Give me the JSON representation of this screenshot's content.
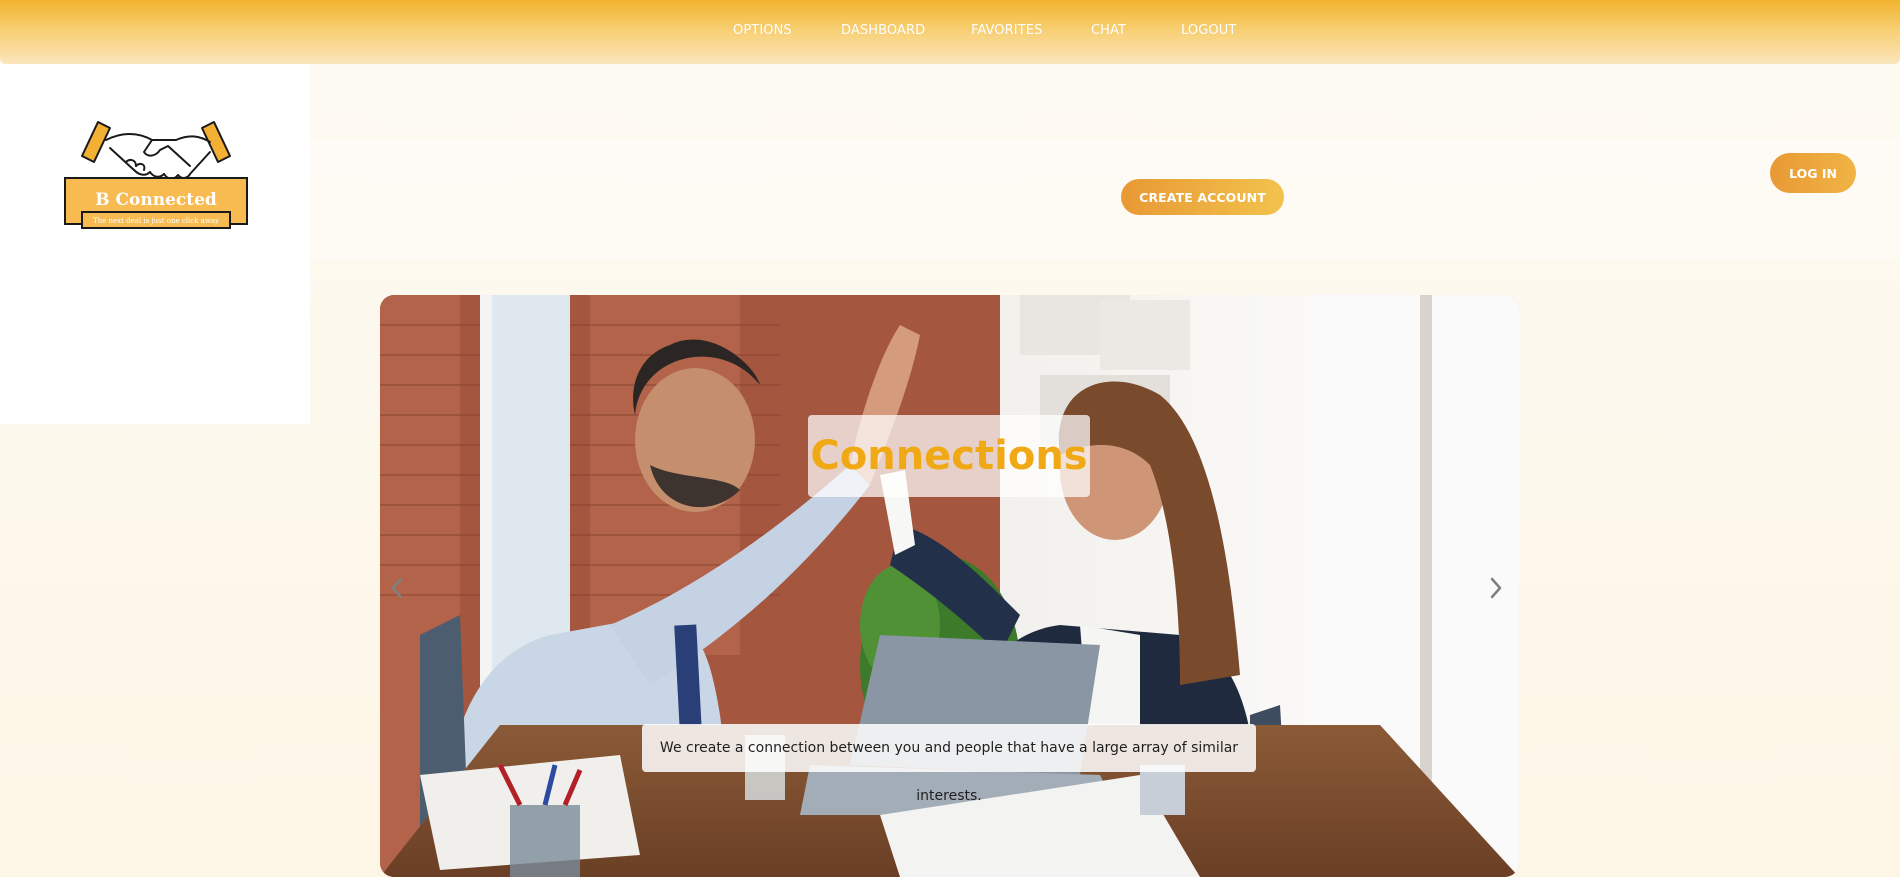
{
  "nav": {
    "items": [
      {
        "label": "OPTIONS"
      },
      {
        "label": "DASHBOARD"
      },
      {
        "label": "FAVORITES"
      },
      {
        "label": "CHAT"
      },
      {
        "label": "LOGOUT"
      }
    ]
  },
  "logo": {
    "name": "B Connected",
    "tagline": "The next deal is just one click away",
    "icon": "handshake-icon"
  },
  "header": {
    "create_account_label": "CREATE ACCOUNT",
    "login_label": "LOG IN"
  },
  "carousel": {
    "title": "Connections",
    "caption": "We create a connection between you and people that have a large array of similar interests.",
    "prev_icon": "chevron-left-icon",
    "next_icon": "chevron-right-icon"
  },
  "colors": {
    "accent": "#f0a914",
    "nav_gradient_top": "#f2b32f",
    "button_gradient_start": "#e89934",
    "button_gradient_end": "#f2c24d"
  }
}
